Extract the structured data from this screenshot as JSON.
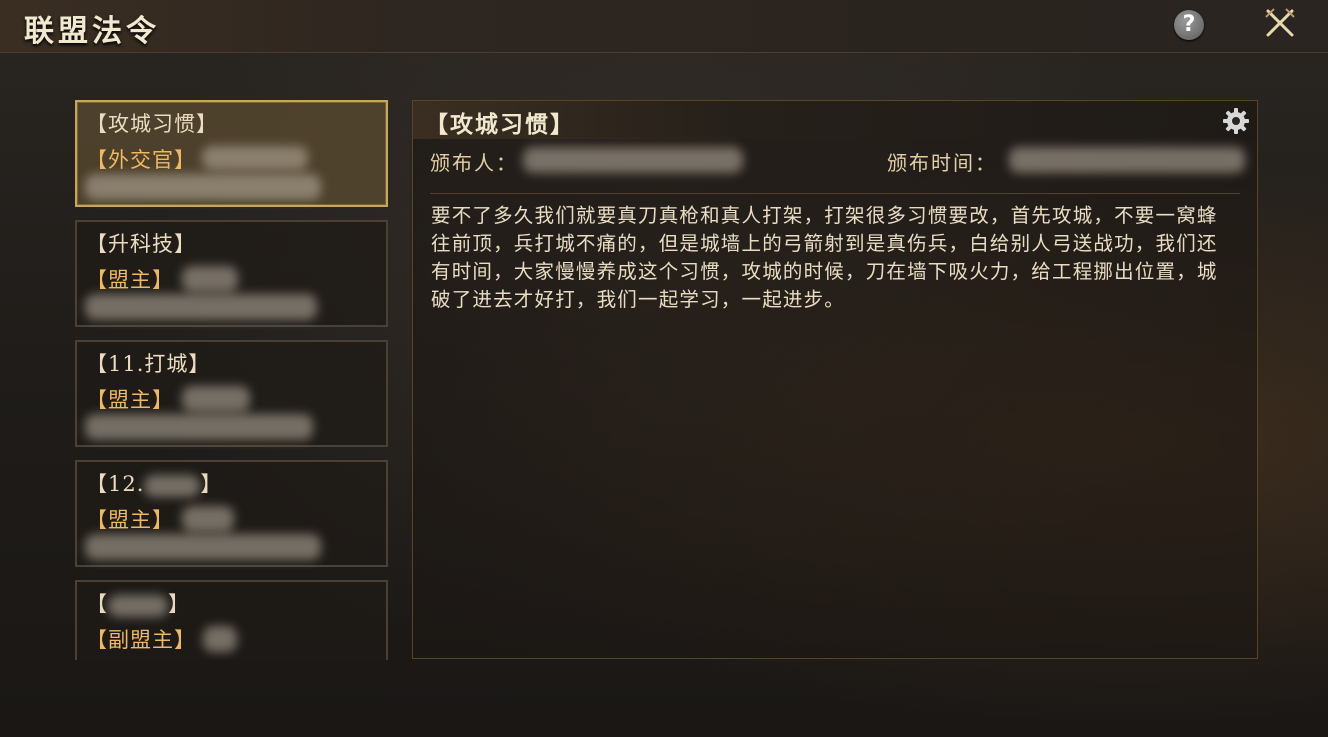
{
  "header": {
    "title": "联盟法令",
    "help_label": "?",
    "close_icon": "crossed-swords-icon"
  },
  "decrees": [
    {
      "title": "【攻城习惯】",
      "role": "【外交官】",
      "selected": true
    },
    {
      "title": "【升科技】",
      "role": "【盟主】",
      "selected": false
    },
    {
      "title": "【11.打城】",
      "role": "【盟主】",
      "selected": false
    },
    {
      "title_prefix": "【12.",
      "title_suffix": "】",
      "role": "【盟主】",
      "selected": false
    },
    {
      "title_prefix": "【",
      "title_suffix": "】",
      "role": "【副盟主】",
      "selected": false
    }
  ],
  "detail": {
    "title": "【攻城习惯】",
    "publisher_label": "颁布人：",
    "time_label": "颁布时间：",
    "body": "要不了多久我们就要真刀真枪和真人打架，打架很多习惯要改，首先攻城，不要一窝蜂往前顶，兵打城不痛的，但是城墙上的弓箭射到是真伤兵，白给别人弓送战功，我们还有时间，大家慢慢养成这个习惯，攻城的时候，刀在墙下吸火力，给工程挪出位置，城破了进去才好打，我们一起学习，一起进步。"
  },
  "colors": {
    "accent_gold": "#c7a75c",
    "role_orange": "#f0b860",
    "text_light": "#e8dcc4"
  }
}
